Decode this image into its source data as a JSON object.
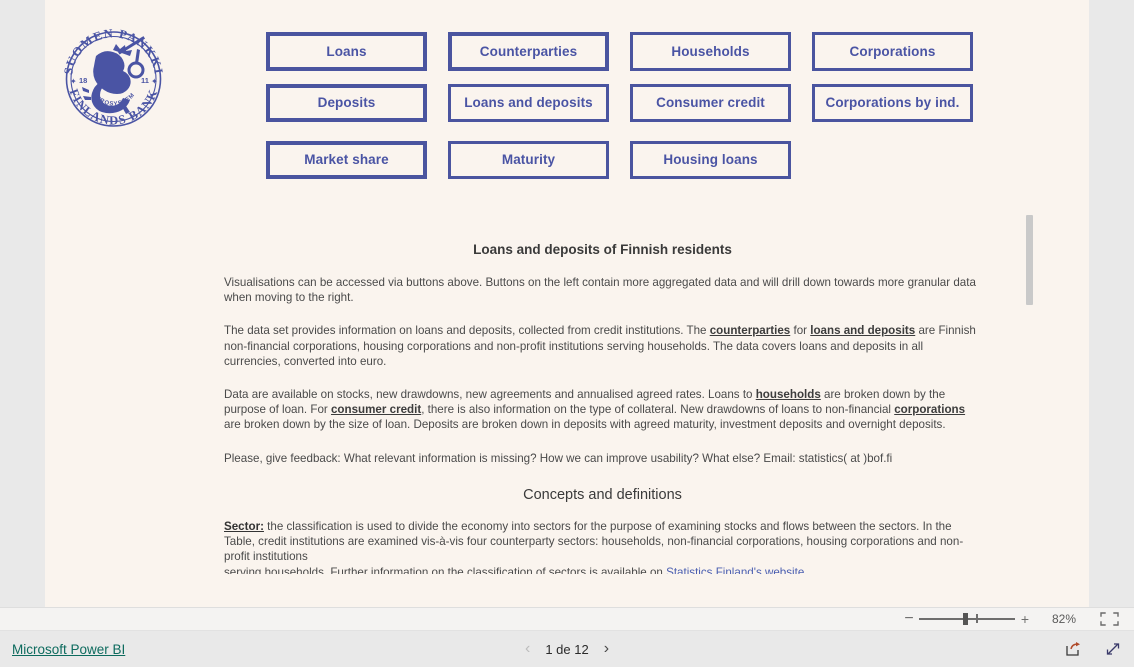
{
  "report": {
    "logo": {
      "icon": "bank-of-finland-seal",
      "top_text": "SUOMEN PANKKI",
      "bottom_text": "FINLANDS BANK",
      "inner_text": "EUROSYSTEM",
      "year_left": "18",
      "year_right": "11",
      "color": "#4a54a4"
    },
    "nav_rows": [
      [
        {
          "label": "Loans",
          "name": "nav-button-loans"
        },
        {
          "label": "Counterparties",
          "name": "nav-button-counterparties"
        },
        {
          "label": "Households",
          "name": "nav-button-households"
        },
        {
          "label": "Corporations",
          "name": "nav-button-corporations"
        }
      ],
      [
        {
          "label": "Deposits",
          "name": "nav-button-deposits"
        },
        {
          "label": "Loans and deposits",
          "name": "nav-button-loans-and-deposits"
        },
        {
          "label": "Consumer credit",
          "name": "nav-button-consumer-credit"
        },
        {
          "label": "Corporations by ind.",
          "name": "nav-button-corporations-by-industry"
        }
      ],
      [
        {
          "label": "Market share",
          "name": "nav-button-market-share"
        },
        {
          "label": "Maturity",
          "name": "nav-button-maturity"
        },
        {
          "label": "Housing loans",
          "name": "nav-button-housing-loans"
        }
      ]
    ],
    "content": {
      "title": "Loans and deposits of Finnish residents",
      "para1": "Visualisations can be accessed via buttons above. Buttons on the left contain more aggregated data and will drill down towards more granular data when moving to the right.",
      "para2_a": "The data set provides information on loans and deposits, collected from credit institutions. The ",
      "para2_link1": "counterparties",
      "para2_b": " for ",
      "para2_link2": "loans and deposits",
      "para2_c": " are Finnish non-financial corporations, housing corporations and non-profit institutions serving households. The data covers loans and deposits in all currencies, converted into euro.",
      "para3_a": "Data are available on stocks, new drawdowns, new agreements and annualised agreed rates. Loans to ",
      "para3_link1": "households",
      "para3_b": " are broken down by the purpose of loan. For ",
      "para3_link2": "consumer credit",
      "para3_c": ", there is also information on the type of collateral. New drawdowns of loans to non-financial ",
      "para3_link3": "corporations",
      "para3_d": " are broken down by the size of loan. Deposits are broken down in deposits with agreed maturity, investment deposits and overnight deposits.",
      "para4": "Please, give feedback: What relevant information is missing? How we can improve usability? What else? Email: statistics( at )bof.fi",
      "heading2": "Concepts and definitions",
      "para5_label": "Sector:",
      "para5_body": " the classification is used to divide the economy into sectors for the purpose of examining stocks and flows between the sectors. In the Table, credit institutions are examined vis-à-vis four counterparty sectors: households, non-financial corporations, housing corporations and non-profit institutions",
      "para6_a": "serving households. Further information on the classification of sectors is available on ",
      "para6_link": "Statistics Finland's website"
    }
  },
  "toolbar": {
    "minus_label": "−",
    "plus_label": "+",
    "zoom_level": "82%",
    "fit_icon": "fit-to-page-icon",
    "slider_icon": "zoom-slider"
  },
  "status": {
    "brand": "Microsoft Power BI",
    "prev_icon": "chevron-left-icon",
    "next_icon": "chevron-right-icon",
    "page_label": "1 de 12",
    "share_icon": "share-icon",
    "fullscreen_icon": "fullscreen-icon"
  }
}
